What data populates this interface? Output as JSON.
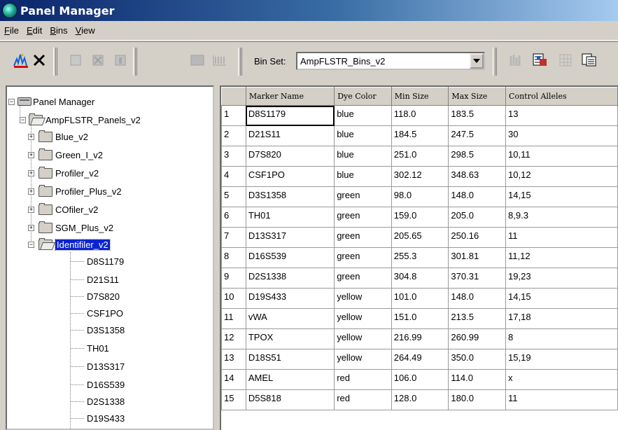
{
  "window": {
    "title": "Panel Manager"
  },
  "menu": [
    {
      "label": "File"
    },
    {
      "label": "Edit"
    },
    {
      "label": "Bins"
    },
    {
      "label": "View"
    }
  ],
  "toolbar": {
    "binset_label": "Bin Set:",
    "binset_value": "AmpFLSTR_Bins_v2"
  },
  "tree": {
    "root": "Panel Manager",
    "kit": "AmpFLSTR_Panels_v2",
    "panels": [
      "Blue_v2",
      "Green_I_v2",
      "Profiler_v2",
      "Profiler_Plus_v2",
      "COfiler_v2",
      "SGM_Plus_v2",
      "Identifiler_v2"
    ],
    "selected_panel": "Identifiler_v2",
    "markers": [
      "D8S1179",
      "D21S11",
      "D7S820",
      "CSF1PO",
      "D3S1358",
      "TH01",
      "D13S317",
      "D16S539",
      "D2S1338",
      "D19S433"
    ]
  },
  "table": {
    "columns": [
      "Marker Name",
      "Dye Color",
      "Min Size",
      "Max Size",
      "Control Alleles"
    ],
    "rows": [
      [
        "1",
        "D8S1179",
        "blue",
        "118.0",
        "183.5",
        "13"
      ],
      [
        "2",
        "D21S11",
        "blue",
        "184.5",
        "247.5",
        "30"
      ],
      [
        "3",
        "D7S820",
        "blue",
        "251.0",
        "298.5",
        "10,11"
      ],
      [
        "4",
        "CSF1PO",
        "blue",
        "302.12",
        "348.63",
        "10,12"
      ],
      [
        "5",
        "D3S1358",
        "green",
        "98.0",
        "148.0",
        "14,15"
      ],
      [
        "6",
        "TH01",
        "green",
        "159.0",
        "205.0",
        "8,9.3"
      ],
      [
        "7",
        "D13S317",
        "green",
        "205.65",
        "250.16",
        "11"
      ],
      [
        "8",
        "D16S539",
        "green",
        "255.3",
        "301.81",
        "11,12"
      ],
      [
        "9",
        "D2S1338",
        "green",
        "304.8",
        "370.31",
        "19,23"
      ],
      [
        "10",
        "D19S433",
        "yellow",
        "101.0",
        "148.0",
        "14,15"
      ],
      [
        "11",
        "vWA",
        "yellow",
        "151.0",
        "213.5",
        "17,18"
      ],
      [
        "12",
        "TPOX",
        "yellow",
        "216.99",
        "260.99",
        "8"
      ],
      [
        "13",
        "D18S51",
        "yellow",
        "264.49",
        "350.0",
        "15,19"
      ],
      [
        "14",
        "AMEL",
        "red",
        "106.0",
        "114.0",
        "x"
      ],
      [
        "15",
        "D5S818",
        "red",
        "128.0",
        "180.0",
        "11"
      ]
    ]
  }
}
